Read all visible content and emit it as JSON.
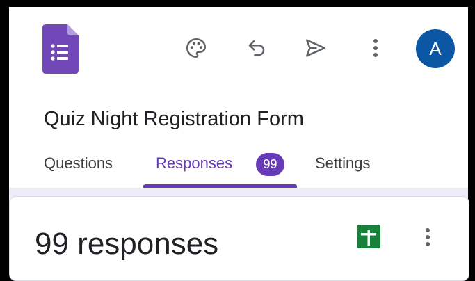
{
  "app": {
    "colors": {
      "accent": "#673ab7",
      "logo": "#7248b9",
      "avatar_bg": "#0b57a4",
      "sheets_green": "#188038",
      "icon_gray": "#5f6368",
      "background": "#f0ebf8"
    }
  },
  "toolbar": {
    "logo_icon": "google-forms-icon",
    "icons": [
      "palette-icon",
      "undo-icon",
      "send-icon",
      "more-vert-icon"
    ],
    "avatar_letter": "A"
  },
  "form": {
    "title": "Quiz Night Registration Form"
  },
  "tabs": [
    {
      "label": "Questions",
      "active": false
    },
    {
      "label": "Responses",
      "active": true,
      "badge": "99"
    },
    {
      "label": "Settings",
      "active": false
    }
  ],
  "responses": {
    "summary": "99 responses",
    "sheets_icon": "google-sheets-icon",
    "menu_icon": "more-vert-icon"
  }
}
